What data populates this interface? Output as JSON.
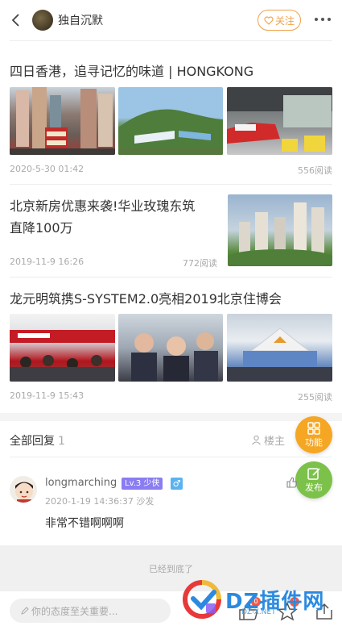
{
  "header": {
    "username": "独自沉默",
    "follow_label": "关注"
  },
  "posts": [
    {
      "title": "四日香港，追寻记忆的味道 | HONGKONG",
      "date": "2020-5-30 01:42",
      "views": "556阅读"
    },
    {
      "title_line1": "北京新房优惠来袭!华业玫瑰东筑",
      "title_line2": "直降100万",
      "date": "2019-11-9 16:26",
      "views": "772阅读"
    },
    {
      "title": "龙元明筑携S-SYSTEM2.0亮相2019北京住博会",
      "date": "2019-11-9 15:43",
      "views": "255阅读"
    }
  ],
  "replies": {
    "header": "全部回复",
    "count": "1",
    "louzhu_label": "楼主"
  },
  "fab": {
    "function_label": "功能",
    "publish_label": "发布"
  },
  "comment": {
    "username": "longmarching",
    "level": "Lv.3 少侠",
    "gender_symbol": "♂",
    "time": "2020-1-19 14:36:37",
    "floor": "沙发",
    "text": "非常不错啊啊啊"
  },
  "footer": {
    "end_text": "已经到底了",
    "comment_placeholder": "你的态度至关重要...",
    "like_badge": "0",
    "star_badge": "0"
  },
  "watermark": {
    "brand": "DZ插件网",
    "url": "DZ-X.NET"
  },
  "colors": {
    "accent_orange": "#f0a14a",
    "fab_orange": "#f5a623",
    "fab_green": "#7cc24a",
    "level_purple": "#8a7df2",
    "gender_blue": "#5ab3ef",
    "badge_red": "#f25a4a"
  }
}
